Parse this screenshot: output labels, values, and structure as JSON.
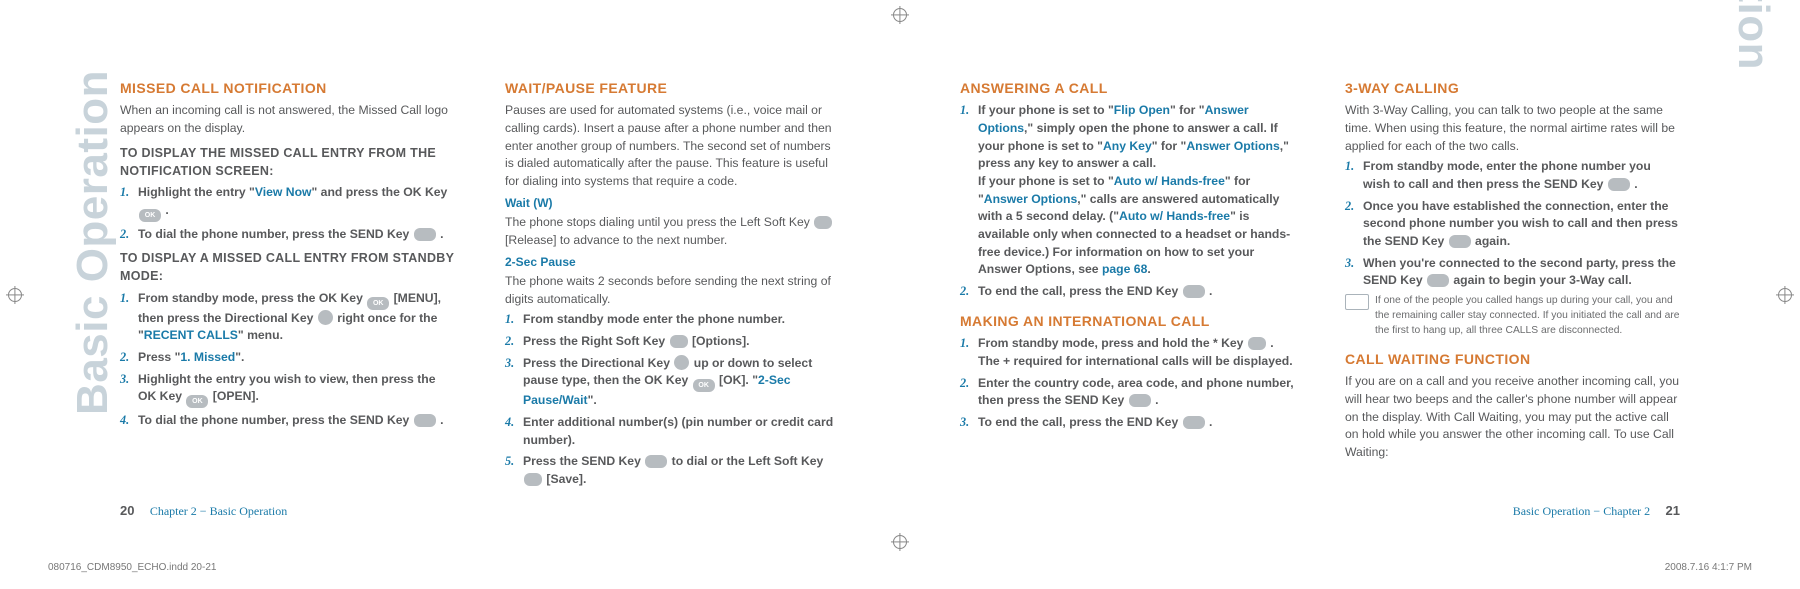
{
  "side_label": "Basic Operation",
  "left": {
    "col1": {
      "h1": "MISSED CALL NOTIFICATION",
      "p1": "When an incoming call is not answered, the Missed Call logo appears on the display.",
      "sub1": "TO DISPLAY THE MISSED CALL ENTRY FROM THE NOTIFICATION SCREEN:",
      "l1_a_pre": "Highlight the entry \"",
      "l1_a_link": "View Now",
      "l1_a_post": "\" and press the OK Key ",
      "l1_a_end": " .",
      "l1_b": "To dial the phone number, press the SEND Key ",
      "l1_b_end": " .",
      "sub2": "TO DISPLAY A MISSED CALL ENTRY FROM STANDBY MODE:",
      "l2_a_pre": "From standby mode, press the OK Key ",
      "l2_a_mid": " [MENU], then press the Directional Key ",
      "l2_a_post": " right once for the \"",
      "l2_a_link": "RECENT CALLS",
      "l2_a_end": "\" menu.",
      "l2_b_pre": "Press \"",
      "l2_b_link": "1. Missed",
      "l2_b_end": "\".",
      "l2_c_pre": "Highlight the entry you wish to view, then press the OK Key ",
      "l2_c_end": " [OPEN].",
      "l2_d": "To dial the phone number, press the SEND Key ",
      "l2_d_end": " ."
    },
    "col2": {
      "h1": "WAIT/PAUSE FEATURE",
      "p1": "Pauses are used for automated systems (i.e., voice mail or calling cards). Insert a pause after a phone number and then enter another group of numbers. The second set of numbers is dialed automatically after the pause. This feature is useful for dialing into systems that require a code.",
      "m1": "Wait (W)",
      "p2_pre": "The phone stops dialing until you press the Left Soft Key ",
      "p2_post": " [Release] to advance to the next number.",
      "m2": "2-Sec Pause",
      "p3": "The phone waits 2 seconds before sending the next string of digits automatically.",
      "l_a": "From standby mode enter the phone number.",
      "l_b_pre": "Press the Right Soft Key ",
      "l_b_post": " [Options].",
      "l_c_pre": "Press the Directional Key ",
      "l_c_mid": " up or down to select pause type, then the OK Key ",
      "l_c_post": " [OK]. \"",
      "l_c_link": "2-Sec Pause/Wait",
      "l_c_end": "\".",
      "l_d": "Enter additional number(s) (pin number or credit card number).",
      "l_e_pre": "Press the SEND Key ",
      "l_e_mid": " to dial or the Left Soft Key ",
      "l_e_post": " [Save]."
    },
    "footer_pg": "20",
    "footer_chap": "Chapter 2 − Basic Operation"
  },
  "right": {
    "col1": {
      "h1": "ANSWERING A CALL",
      "l1_pre": "If your phone is set to \"",
      "l1_l1": "Flip Open",
      "l1_m1": "\" for \"",
      "l1_l2": "Answer Options",
      "l1_m2": ",\" simply open the phone to answer a call. If your phone is set to \"",
      "l1_l3": "Any Key",
      "l1_m3": "\" for \"",
      "l1_l4": "Answer Options",
      "l1_m4": ",\" press any key to answer a call.",
      "l1_br": "If your phone is set to \"",
      "l1_l5": "Auto w/ Hands-free",
      "l1_m5": "\" for \"",
      "l1_l6": "Answer Options",
      "l1_m6": ",\" calls are answered automatically with a 5 second delay. (\"",
      "l1_l7": "Auto w/ Hands-free",
      "l1_m7": "\" is available only when connected to a headset or hands-free device.) For information on how to set your Answer Options, see ",
      "l1_l8": "page 68",
      "l1_end": ".",
      "l2_pre": "To end the call, press the END Key ",
      "l2_end": " .",
      "h2": "MAKING AN INTERNATIONAL CALL",
      "i1_pre": "From standby mode, press and hold the * Key ",
      "i1_post": " . The + required for international calls will be displayed.",
      "i2_pre": "Enter the country code, area code, and phone number, then press the SEND Key ",
      "i2_end": " .",
      "i3_pre": "To end the call, press the END Key ",
      "i3_end": " ."
    },
    "col2": {
      "h1": "3-WAY CALLING",
      "p1": "With 3-Way Calling, you can talk to two people at the same time. When using this feature, the normal airtime rates will be applied for each of the two calls.",
      "l1_pre": "From standby mode, enter the phone number you wish to call and then press the SEND Key ",
      "l1_end": " .",
      "l2_pre": "Once you have established the connection, enter the second phone number you wish to call and then press the SEND Key ",
      "l2_end": " again.",
      "l3_pre": "When you're connected to the second party, press the SEND Key ",
      "l3_end": " again to begin your 3-Way call.",
      "note": "If one of the people you called hangs up during your call, you and the remaining caller stay connected. If you initiated the call and are the first to hang up, all three CALLS are disconnected.",
      "h2": "CALL WAITING FUNCTION",
      "p2": "If you are on a call and you receive another incoming call, you will hear two beeps and the caller's phone number will appear on the display. With Call Waiting, you may put the active call on hold while you answer the other incoming call. To use Call Waiting:"
    },
    "footer_chap": "Basic Operation − Chapter 2",
    "footer_pg": "21"
  },
  "print": {
    "left": "080716_CDM8950_ECHO.indd   20-21",
    "right": "2008.7.16   4:1:7 PM"
  },
  "keys": {
    "ok": "OK",
    "send": "",
    "dir": "",
    "soft": "",
    "star": ""
  }
}
